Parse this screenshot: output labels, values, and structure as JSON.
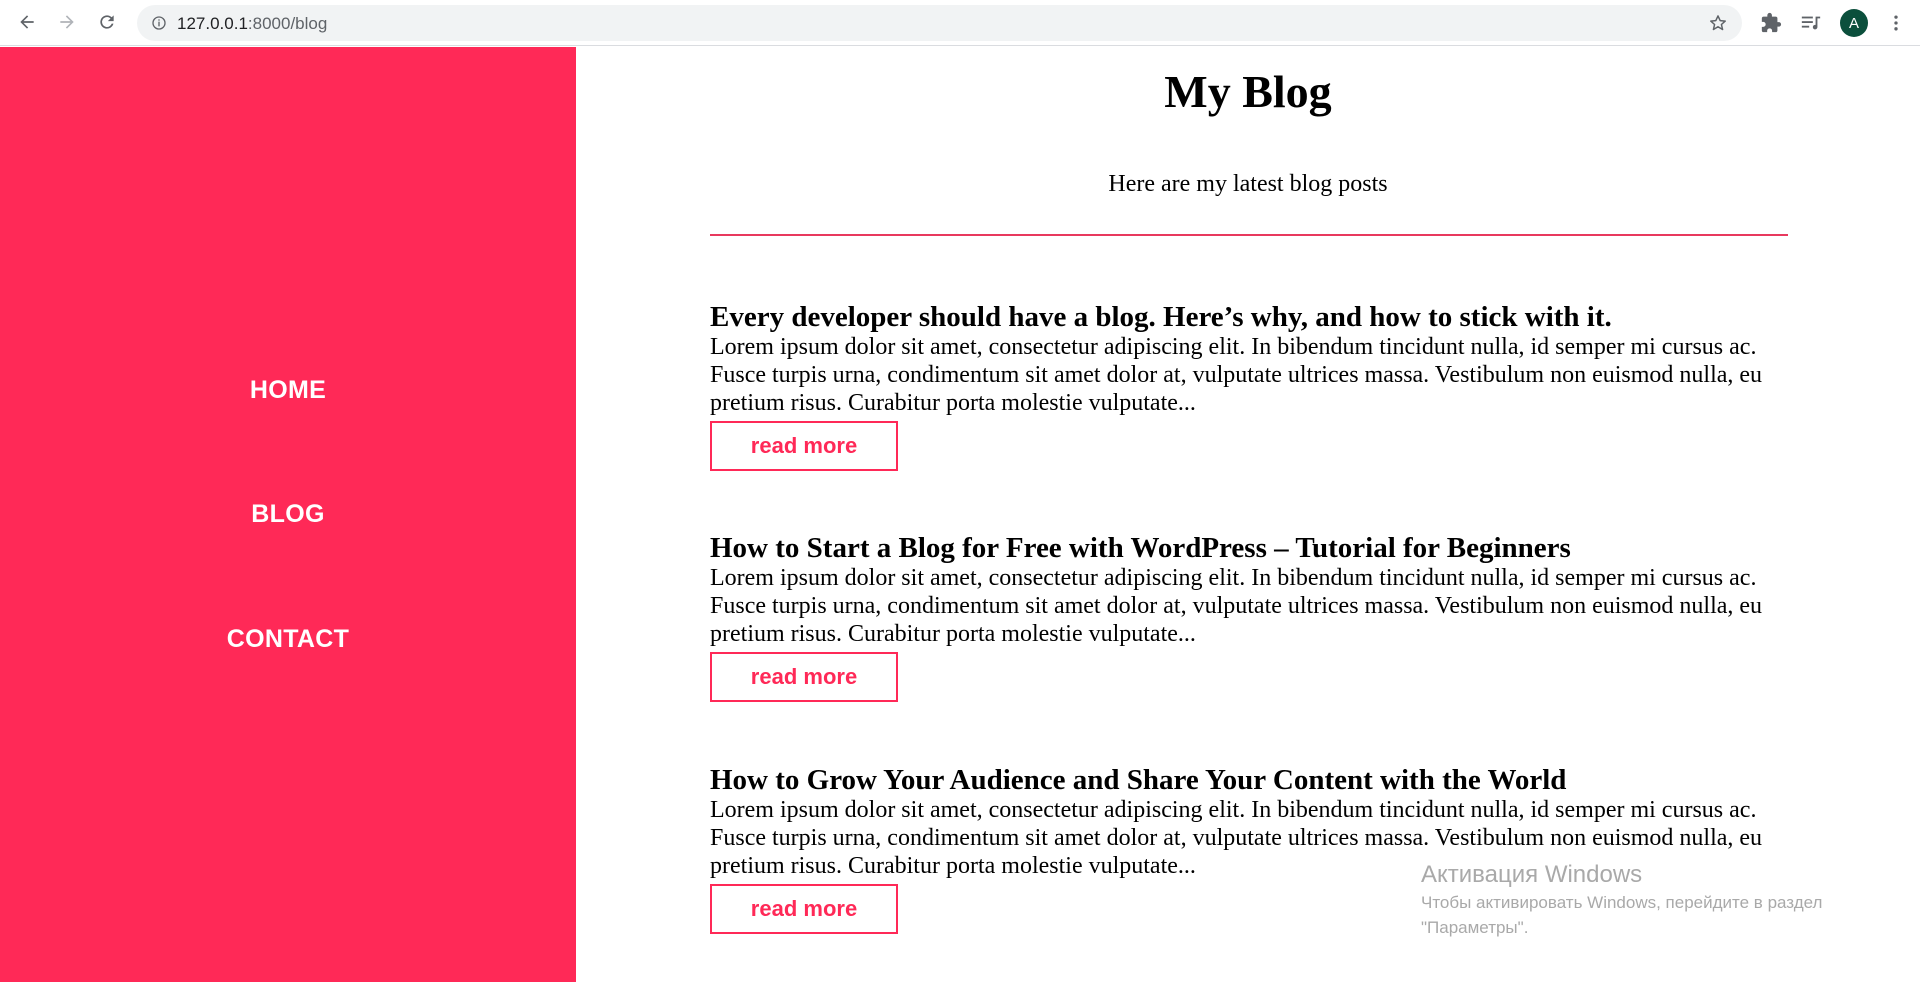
{
  "browser": {
    "url_host": "127.0.0.1",
    "url_path": ":8000/blog",
    "avatar_letter": "A"
  },
  "sidebar": {
    "items": [
      {
        "label": "HOME"
      },
      {
        "label": "BLOG"
      },
      {
        "label": "CONTACT"
      }
    ]
  },
  "main": {
    "title": "My Blog",
    "subtitle": "Here are my latest blog posts",
    "posts": [
      {
        "title": "Every developer should have a blog. Here’s why, and how to stick with it.",
        "excerpt": "Lorem ipsum dolor sit amet, consectetur adipiscing elit. In bibendum tincidunt nulla, id semper mi cursus ac. Fusce turpis urna, condimentum sit amet dolor at, vulputate ultrices massa. Vestibulum non euismod nulla, eu pretium risus. Curabitur porta molestie vulputate...",
        "button": "read more"
      },
      {
        "title": "How to Start a Blog for Free with WordPress – Tutorial for Beginners",
        "excerpt": "Lorem ipsum dolor sit amet, consectetur adipiscing elit. In bibendum tincidunt nulla, id semper mi cursus ac. Fusce turpis urna, condimentum sit amet dolor at, vulputate ultrices massa. Vestibulum non euismod nulla, eu pretium risus. Curabitur porta molestie vulputate...",
        "button": "read more"
      },
      {
        "title": "How to Grow Your Audience and Share Your Content with the World",
        "excerpt": "Lorem ipsum dolor sit amet, consectetur adipiscing elit. In bibendum tincidunt nulla, id semper mi cursus ac. Fusce turpis urna, condimentum sit amet dolor at, vulputate ultrices massa. Vestibulum non euismod nulla, eu pretium risus. Curabitur porta molestie vulputate...",
        "button": "read more"
      }
    ]
  },
  "watermark": {
    "title": "Активация Windows",
    "line1": "Чтобы активировать Windows, перейдите в раздел",
    "line2": "\"Параметры\"."
  },
  "colors": {
    "accent": "#ff2957",
    "divider": "#e8395e",
    "avatar": "#0b4f3c"
  }
}
